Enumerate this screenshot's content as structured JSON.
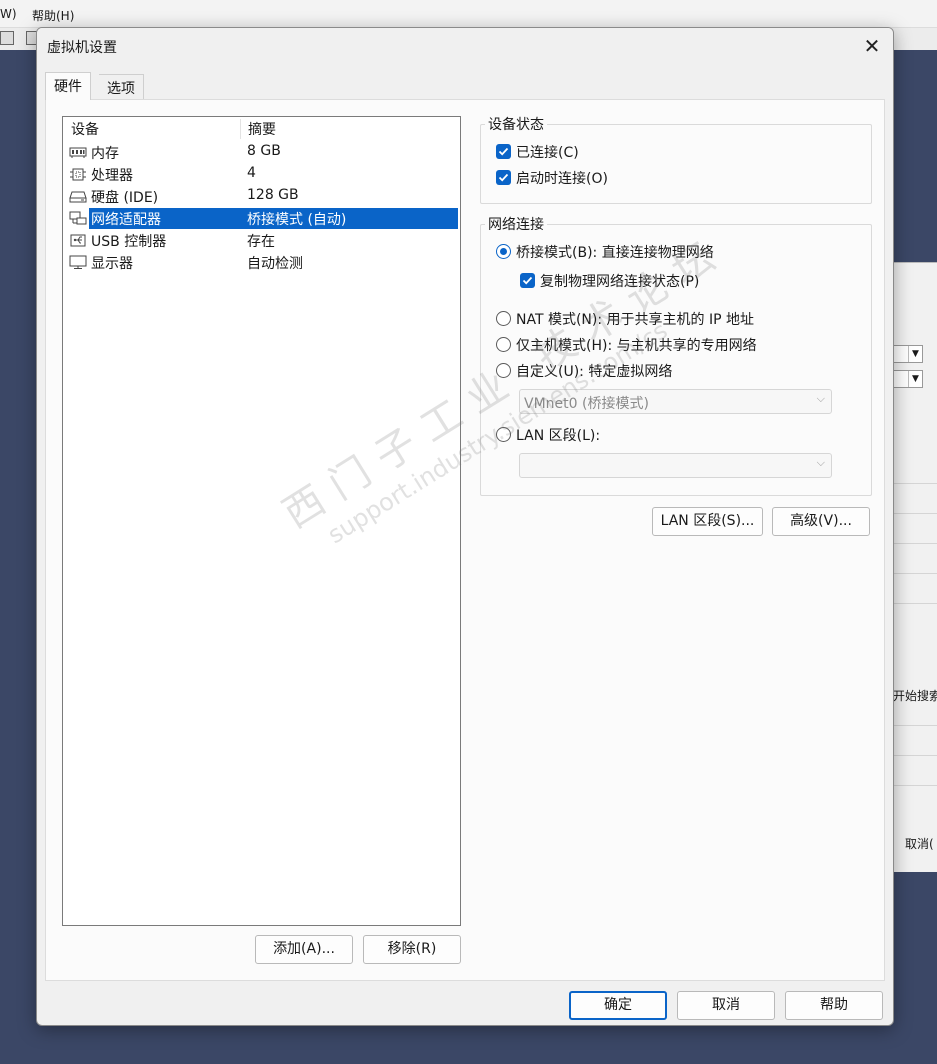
{
  "background_app": {
    "menu": [
      "W)",
      "帮助(H)"
    ],
    "panel_texts": [
      "开始搜索",
      "取消("
    ]
  },
  "dialog": {
    "title": "虚拟机设置",
    "tabs": [
      "硬件",
      "选项"
    ],
    "device_list": {
      "headers": [
        "设备",
        "摘要"
      ],
      "rows": [
        {
          "name": "内存",
          "summary": "8 GB",
          "icon": "memory-icon"
        },
        {
          "name": "处理器",
          "summary": "4",
          "icon": "processor-icon"
        },
        {
          "name": "硬盘 (IDE)",
          "summary": "128 GB",
          "icon": "hard-disk-icon"
        },
        {
          "name": "网络适配器",
          "summary": "桥接模式 (自动)",
          "icon": "network-adapter-icon",
          "selected": true
        },
        {
          "name": "USB 控制器",
          "summary": "存在",
          "icon": "usb-icon"
        },
        {
          "name": "显示器",
          "summary": "自动检测",
          "icon": "display-icon"
        }
      ],
      "add_button": "添加(A)...",
      "remove_button": "移除(R)"
    },
    "device_status": {
      "label": "设备状态",
      "connected": {
        "label": "已连接(C)",
        "checked": true
      },
      "connect_at_power_on": {
        "label": "启动时连接(O)",
        "checked": true
      }
    },
    "network_connection": {
      "label": "网络连接",
      "bridged": {
        "label": "桥接模式(B): 直接连接物理网络",
        "selected": true
      },
      "replicate": {
        "label": "复制物理网络连接状态(P)",
        "checked": true
      },
      "nat": {
        "label": "NAT 模式(N): 用于共享主机的 IP 地址",
        "selected": false
      },
      "host_only": {
        "label": "仅主机模式(H): 与主机共享的专用网络",
        "selected": false
      },
      "custom": {
        "label": "自定义(U): 特定虚拟网络",
        "selected": false
      },
      "custom_value": "VMnet0 (桥接模式)",
      "lan_segment": {
        "label": "LAN 区段(L):",
        "selected": false
      },
      "lan_segment_value": ""
    },
    "lan_segments_button": "LAN 区段(S)...",
    "advanced_button": "高级(V)...",
    "footer": {
      "ok": "确定",
      "cancel": "取消",
      "help": "帮助"
    },
    "watermark": {
      "line1": "西门子工业 技术论坛",
      "line2": "support.industry.siemens.com/cs"
    }
  },
  "colors": {
    "accent": "#0a64c8",
    "desktop": "#3b4766"
  }
}
